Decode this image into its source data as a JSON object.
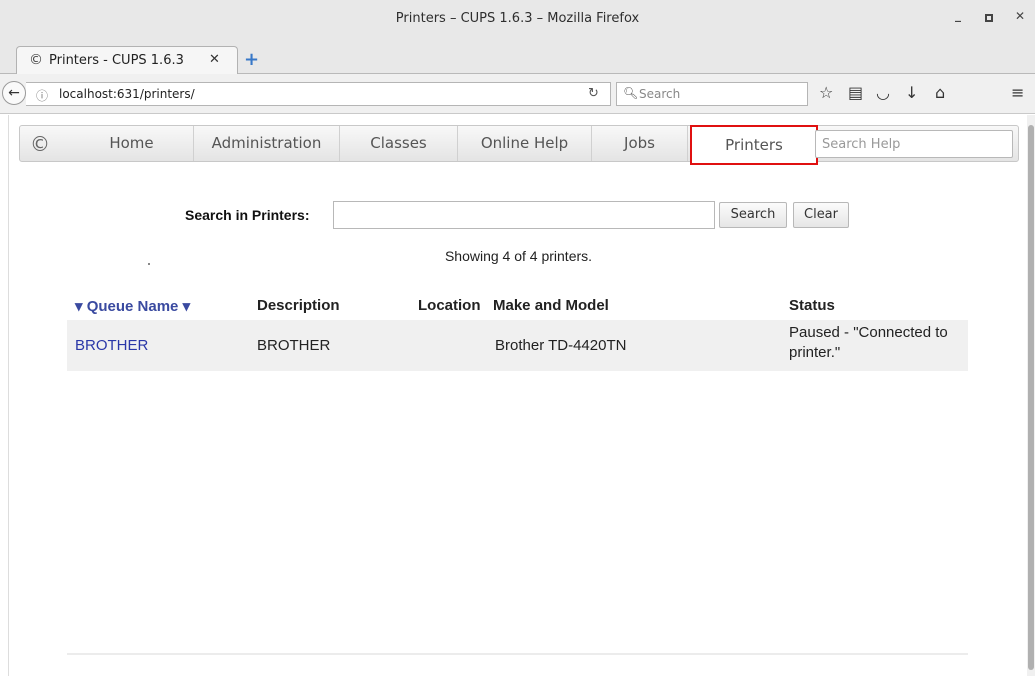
{
  "window": {
    "title": "Printers – CUPS 1.6.3 – Mozilla Firefox"
  },
  "tab": {
    "label": "Printers - CUPS 1.6.3"
  },
  "navbar": {
    "url": "localhost:631/printers/",
    "search_placeholder": "Search"
  },
  "cups_nav": {
    "items": [
      "Home",
      "Administration",
      "Classes",
      "Online Help",
      "Jobs",
      "Printers"
    ],
    "active": "Printers",
    "search_placeholder": "Search Help"
  },
  "search": {
    "label": "Search in Printers:",
    "value": "",
    "search_button": "Search",
    "clear_button": "Clear"
  },
  "summary": "Showing 4 of 4 printers.",
  "table": {
    "headers": {
      "queue_name": "▾ Queue Name ▾",
      "description": "Description",
      "location": "Location",
      "make_model": "Make and Model",
      "status": "Status"
    },
    "rows": [
      {
        "queue_name": "BROTHER",
        "description": "BROTHER",
        "location": "",
        "make_model": "Brother TD-4420TN",
        "status_line1": "Paused - \"Connected to",
        "status_line2": "printer.\""
      }
    ]
  },
  "colors": {
    "active_outline": "#e01010",
    "link": "#2a37a8"
  }
}
